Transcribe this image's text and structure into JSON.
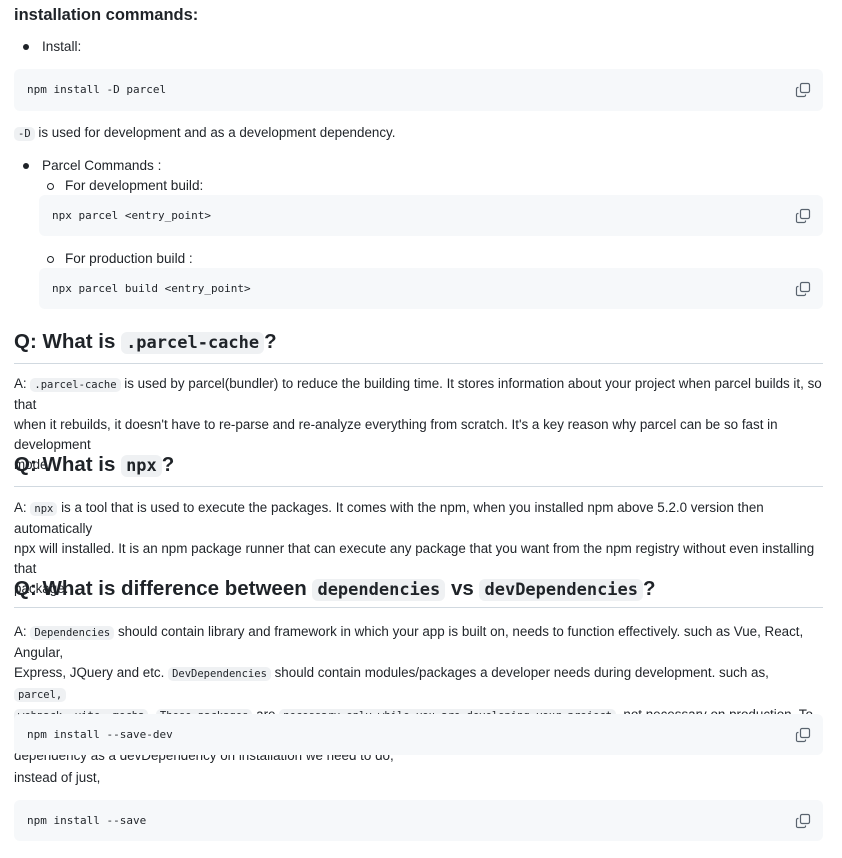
{
  "heading": "installation commands:",
  "install_item": "Install:",
  "code_install": "npm install -D parcel",
  "dev_flag": {
    "code": "-D",
    "text": " is used for development and as a development dependency."
  },
  "parcel_commands": {
    "label": "Parcel Commands :",
    "dev_label": "For development build:",
    "dev_code": "npx parcel <entry_point>",
    "prod_label": "For production build :",
    "prod_code": "npx parcel build <entry_point>"
  },
  "q_cache": {
    "prefix": "Q: What is ",
    "code": ".parcel-cache",
    "suffix": "?",
    "answer_prefix": "A: ",
    "answer_code": ".parcel-cache",
    "answer_line1": " is used by parcel(bundler) to reduce the building time. It stores information about your project when parcel builds it, so that",
    "answer_line2": "when it rebuilds, it doesn't have to re-parse and re-analyze everything from scratch. It's a key reason why parcel can be so fast in development",
    "answer_line3": "mode."
  },
  "q_npx": {
    "prefix": "Q: What is ",
    "code": "npx",
    "suffix": "?",
    "answer_prefix": "A: ",
    "answer_code": "npx",
    "answer_line1": " is a tool that is used to execute the packages. It comes with the npm, when you installed npm above 5.2.0 version then automatically",
    "answer_line2": "npx will installed. It is an npm package runner that can execute any package that you want from the npm registry without even installing that",
    "answer_line3": "package."
  },
  "q_deps": {
    "prefix": "Q: What is difference between ",
    "code1": "dependencies",
    "middle": " vs ",
    "code2": "devDependencies",
    "suffix": "?",
    "l1_prefix": "A: ",
    "l1_code": "Dependencies",
    "l1_text": " should contain library and framework in which your app is built on, needs to function effectively. such as Vue, React, Angular,",
    "l2_text1": "Express, JQuery and etc. ",
    "l2_code": "DevDependencies",
    "l2_text2": " should contain modules/packages a developer needs during development. such as, ",
    "l2_code2": "parcel,",
    "l3_code1": "webpack, vite, mocha",
    "l3_sep1": ". ",
    "l3_code2": "These packages",
    "l3_text1": " are ",
    "l3_code3": "necessary only while you are developing your project",
    "l3_text2": ", not necessary on production. To save a",
    "l4_text": "dependency as a devDependency on installation we need to do,"
  },
  "code_save_dev": "npm install --save-dev",
  "instead_text": "instead of just,",
  "code_save": "npm install --save",
  "colors": {
    "text": "#1f2328",
    "code_bg": "#f6f8fa",
    "inline_code_bg": "#eff1f3",
    "rule": "#d1d9e0",
    "icon": "#59636e"
  }
}
